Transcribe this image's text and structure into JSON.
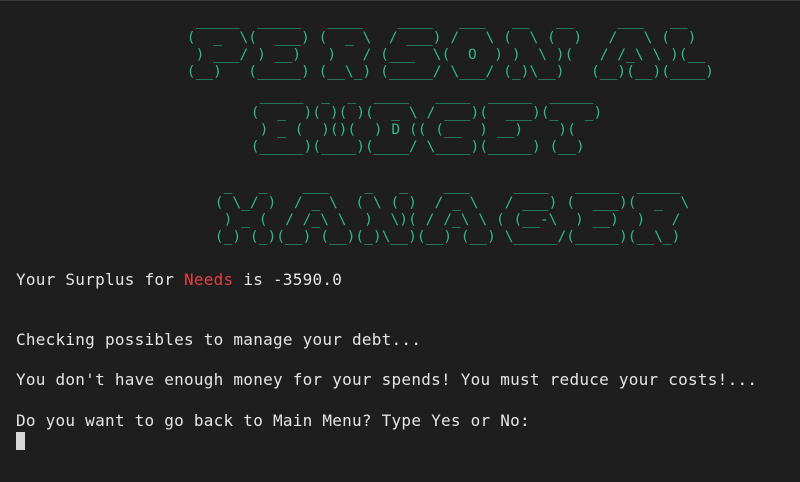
{
  "banner": {
    "personal": [
      "  _____  _____   ____    ____   ___   __   __     ___   __",
      " (  _  \\(  ___) (  _ \\  / ___) /   \\ (  \\ (  )   /   \\ (  )",
      "  ) ___/ ) __)   )   / (___  \\(  O  ) )  \\ )(   / /_\\ \\ )(__",
      " (__)   (_____) (__\\_) (_____/ \\___/ (_)\\__)   (__)(__)(____)"
    ],
    "budget": [
      "  _____  _  _  ____   ____  _____  _____",
      " (  _  )( )( )(  _ \\ / ___)(  ___)(_   _)",
      "  ) _ (  )()(  ) D (( (__  ) __)    )(",
      " (_____)(____)(____/ \\____)(_____) (__)"
    ],
    "manager": [
      "  _   _    ___    _   _    ___     ____   _____  _____",
      " ( \\_/ )  / _ \\  ( \\ ( )  / _ \\   / ___) (  ___)(  _  \\",
      "  ) _ (  / /_\\ \\  )  \\)( / /_\\ \\ ( (__-\\  ) __)  )   /",
      " (_) (_)(__) (__)(_)\\__)(__) (__) \\_____/(_____)(__\\_)"
    ]
  },
  "output": {
    "surplus_prefix": "Your Surplus for ",
    "surplus_category": "Needs",
    "surplus_suffix": " is -3590.0",
    "checking": "Checking possibles to manage your debt...",
    "warning": "You don't have enough money for your spends! You must reduce your costs!...",
    "prompt": "Do you want to go back to Main Menu? Type Yes or No:"
  },
  "colors": {
    "background": "#1e1e1e",
    "text": "#e5e5e5",
    "banner": "#2fb88a",
    "highlight": "#e34040",
    "cursor": "#d8d8d8"
  }
}
